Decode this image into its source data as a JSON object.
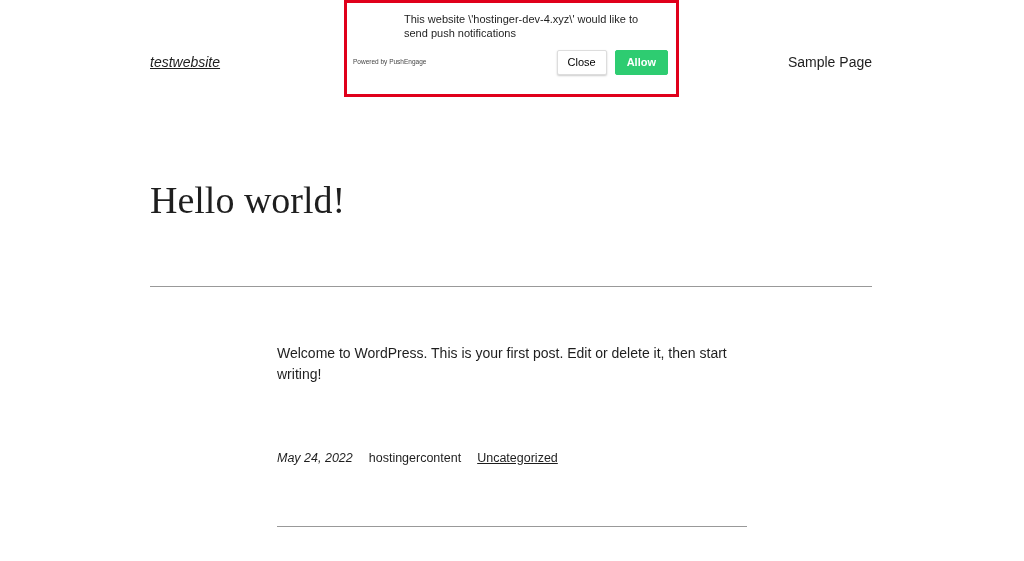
{
  "header": {
    "site_title": "testwebsite",
    "nav_items": [
      "Sample Page"
    ]
  },
  "push_prompt": {
    "message": "This website \\'hostinger-dev-4.xyz\\' would like to send push notifications",
    "powered_by": "Powered by PushEngage",
    "close_label": "Close",
    "allow_label": "Allow",
    "highlighted": true
  },
  "post": {
    "title": "Hello world!",
    "body": "Welcome to WordPress. This is your first post. Edit or delete it, then start writing!",
    "date": "May 24, 2022",
    "author": "hostingercontent",
    "category": "Uncategorized"
  }
}
